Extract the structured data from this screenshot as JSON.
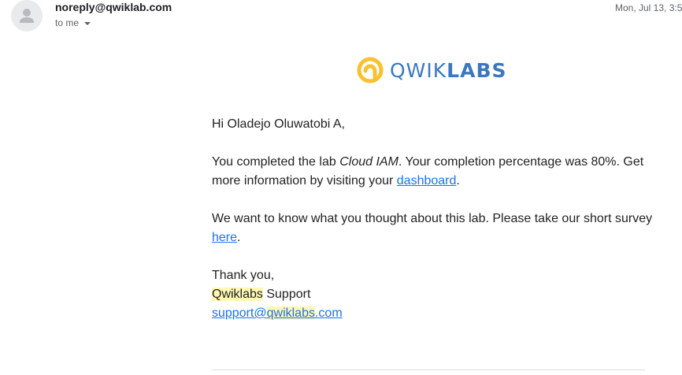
{
  "header": {
    "sender": "noreply@qwiklab.com",
    "recipients": "to me",
    "date": "Mon, Jul 13, 3:5"
  },
  "logo": {
    "part1": "QWIK",
    "part2": "LABS",
    "icon": "qwiklabs-logo-icon",
    "colors": {
      "icon": "#f9c12d",
      "text": "#3b78bf"
    }
  },
  "email": {
    "greeting": "Hi Oladejo Oluwatobi A,",
    "p1_pre": "You completed the lab ",
    "p1_lab": "Cloud IAM",
    "p1_mid": ". Your completion percentage was 80%. Get more information by visiting your ",
    "p1_link": "dashboard",
    "p1_post": ".",
    "p2_pre": "We want to know what you thought about this lab. Please take our short survey ",
    "p2_link": "here",
    "p2_post": ".",
    "signoff": "Thank you,",
    "sig_brand": "Qwiklabs",
    "sig_rest": " Support",
    "email_pre": "support@",
    "email_hl": "qwiklabs",
    "email_post": ".com"
  },
  "colors": {
    "link": "#1a73e8",
    "highlight": "#fff8b5"
  }
}
